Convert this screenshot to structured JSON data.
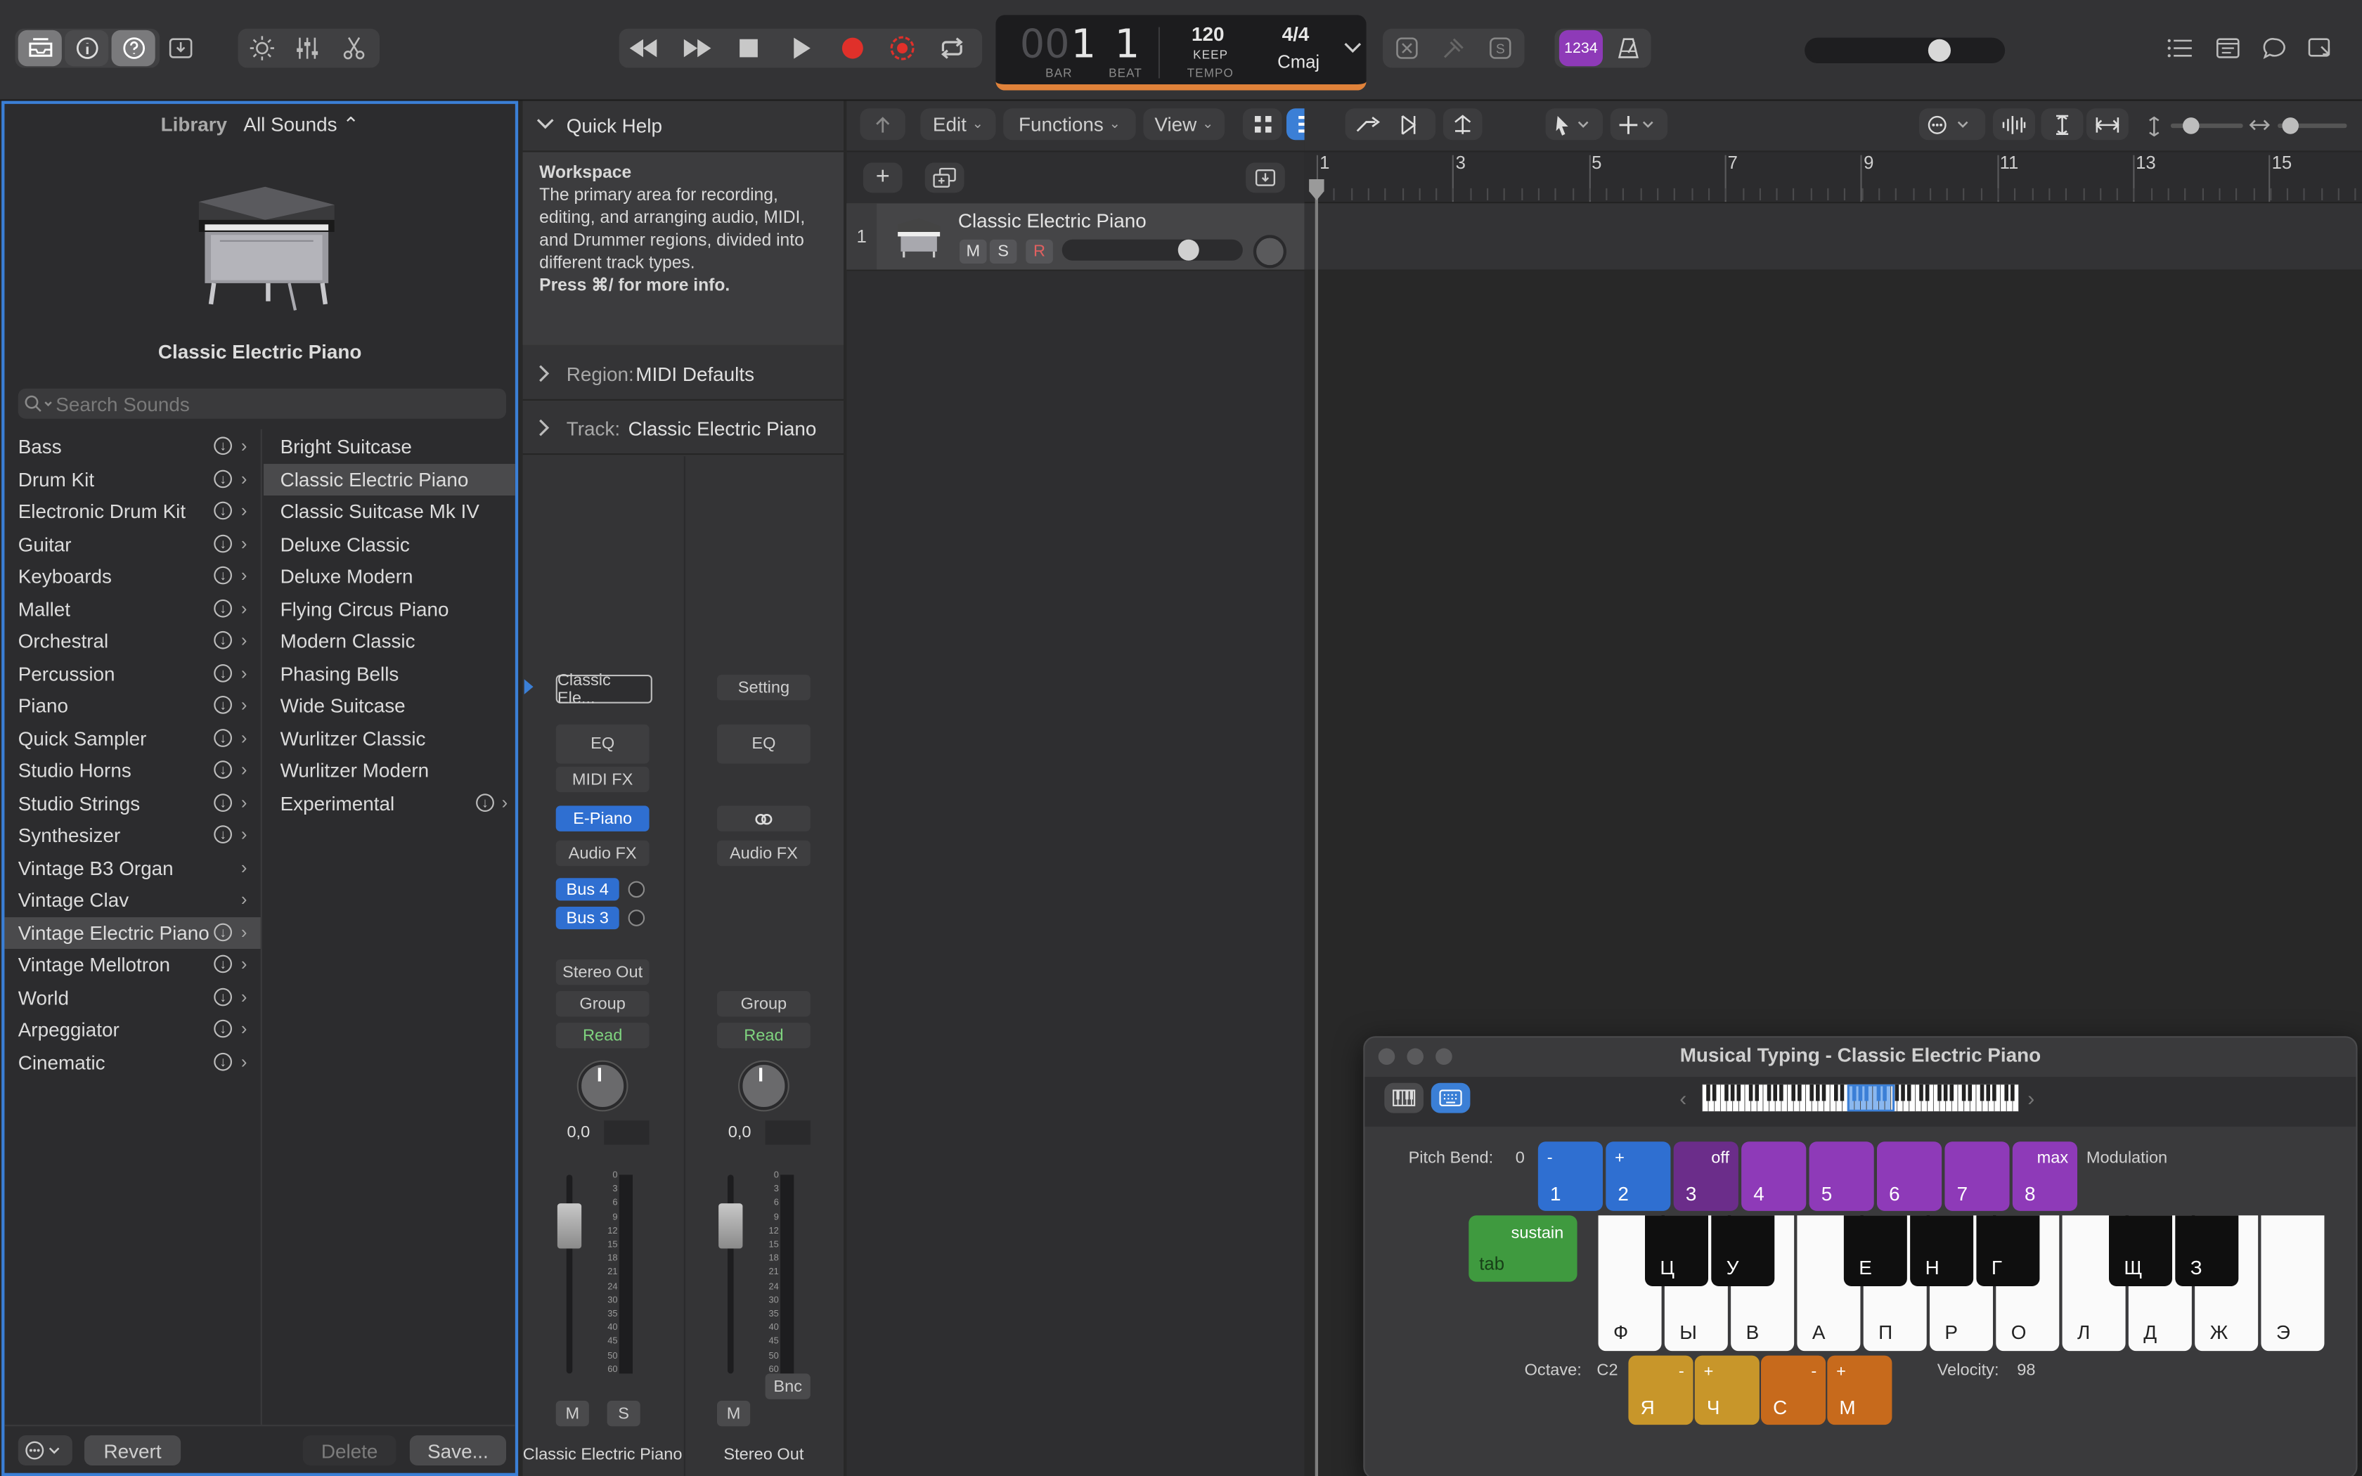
{
  "toolbar": {
    "lcd": {
      "bar_prefix": "00",
      "bar": "1",
      "beat": "1",
      "bar_label": "BAR",
      "beat_label": "BEAT",
      "tempo": "120",
      "tempo_mode": "KEEP",
      "tempo_label": "TEMPO",
      "time_sig": "4/4",
      "key": "Cmaj"
    },
    "count_in_label": "1234"
  },
  "library": {
    "title": "Library",
    "filter": "All Sounds ⌃",
    "patch_name": "Classic Electric Piano",
    "search_placeholder": "Search Sounds",
    "categories": [
      {
        "label": "Bass"
      },
      {
        "label": "Drum Kit"
      },
      {
        "label": "Electronic Drum Kit"
      },
      {
        "label": "Guitar"
      },
      {
        "label": "Keyboards"
      },
      {
        "label": "Mallet"
      },
      {
        "label": "Orchestral"
      },
      {
        "label": "Percussion"
      },
      {
        "label": "Piano"
      },
      {
        "label": "Quick Sampler"
      },
      {
        "label": "Studio Horns"
      },
      {
        "label": "Studio Strings"
      },
      {
        "label": "Synthesizer"
      },
      {
        "label": "Vintage B3 Organ"
      },
      {
        "label": "Vintage Clav"
      },
      {
        "label": "Vintage Electric Piano"
      },
      {
        "label": "Vintage Mellotron"
      },
      {
        "label": "World"
      },
      {
        "label": "Arpeggiator"
      },
      {
        "label": "Cinematic"
      }
    ],
    "patches": [
      {
        "label": "Bright Suitcase"
      },
      {
        "label": "Classic Electric Piano"
      },
      {
        "label": "Classic Suitcase Mk IV"
      },
      {
        "label": "Deluxe Classic"
      },
      {
        "label": "Deluxe Modern"
      },
      {
        "label": "Flying Circus Piano"
      },
      {
        "label": "Modern Classic"
      },
      {
        "label": "Phasing Bells"
      },
      {
        "label": "Wide Suitcase"
      },
      {
        "label": "Wurlitzer Classic"
      },
      {
        "label": "Wurlitzer Modern"
      },
      {
        "label": "Experimental"
      }
    ],
    "revert_label": "Revert",
    "delete_label": "Delete",
    "save_label": "Save..."
  },
  "quick_help": {
    "header": "Quick Help",
    "title": "Workspace",
    "body": "The primary area for recording, editing, and arranging audio, MIDI, and Drummer regions, divided into different track types.",
    "shortcut": "Press ⌘/ for more info.",
    "region_label": "Region:",
    "region_value": "MIDI Defaults",
    "track_label": "Track:",
    "track_value": "Classic Electric Piano"
  },
  "channel_strips": [
    {
      "setting": "Classic Ele...",
      "eq": "EQ",
      "midi_fx": "MIDI FX",
      "instrument": "E-Piano",
      "audio_fx": "Audio FX",
      "sends": [
        "Bus 4",
        "Bus 3"
      ],
      "output": "Stereo Out",
      "group": "Group",
      "automation": "Read",
      "volume": "0,0",
      "mute": "M",
      "solo": "S",
      "name": "Classic Electric Piano"
    },
    {
      "setting": "Setting",
      "eq": "EQ",
      "audio_fx": "Audio FX",
      "group": "Group",
      "automation": "Read",
      "volume": "0,0",
      "mute": "M",
      "bounce": "Bnc",
      "name": "Stereo Out"
    }
  ],
  "meter_scale": [
    "0",
    "3",
    "6",
    "9",
    "12",
    "15",
    "18",
    "21",
    "24",
    "30",
    "35",
    "40",
    "45",
    "50",
    "60"
  ],
  "tracks_menu": {
    "edit": "Edit",
    "functions": "Functions",
    "view": "View"
  },
  "tracks": [
    {
      "number": "1",
      "name": "Classic Electric Piano",
      "mute": "M",
      "solo": "S",
      "record": "R"
    }
  ],
  "ruler": [
    "1",
    "3",
    "5",
    "7",
    "9",
    "11",
    "13",
    "15"
  ],
  "musical_typing": {
    "title": "Musical Typing - Classic Electric Piano",
    "pitch_bend_label": "Pitch Bend:",
    "pitch_bend_value": "0",
    "modulation_label": "Modulation",
    "number_keys": [
      {
        "top": "-",
        "num": "1"
      },
      {
        "top": "+",
        "num": "2"
      },
      {
        "top": "off",
        "num": "3"
      },
      {
        "top": "",
        "num": "4"
      },
      {
        "top": "",
        "num": "5"
      },
      {
        "top": "",
        "num": "6"
      },
      {
        "top": "",
        "num": "7"
      },
      {
        "top": "max",
        "num": "8"
      }
    ],
    "sustain_label": "sustain",
    "tab_label": "tab",
    "white_keys": [
      "Ф",
      "Ы",
      "В",
      "А",
      "П",
      "Р",
      "О",
      "Л",
      "Д",
      "Ж",
      "Э"
    ],
    "black_keys": [
      "Ц",
      "У",
      "Е",
      "Н",
      "Г",
      "Щ",
      "З"
    ],
    "octave_label": "Octave:",
    "octave_value": "C2",
    "velocity_label": "Velocity:",
    "velocity_value": "98",
    "octave_keys": [
      {
        "top": "-",
        "letter": "Я"
      },
      {
        "top": "+",
        "letter": "Ч"
      }
    ],
    "velocity_keys": [
      {
        "top": "-",
        "letter": "С"
      },
      {
        "top": "+",
        "letter": "М"
      }
    ]
  },
  "colors": {
    "accent": "#3b7fd6",
    "record": "#e0302a",
    "purple": "#8e3ab8",
    "blue": "#2f6fd1",
    "green": "#3f9a3f",
    "orange": "#c76a1c",
    "gold": "#c8962a"
  }
}
